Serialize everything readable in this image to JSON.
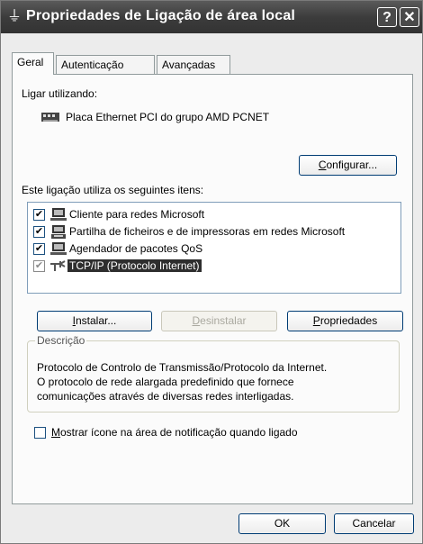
{
  "window": {
    "title": "Propriedades de Ligação de área local",
    "help_btn": "?",
    "close_btn": "✕"
  },
  "tabs": [
    {
      "label": "Geral",
      "active": true
    },
    {
      "label": "Autenticação",
      "active": false
    },
    {
      "label": "Avançadas",
      "active": false
    }
  ],
  "general": {
    "connect_using_label": "Ligar utilizando:",
    "adapter_name": "Placa Ethernet PCI do grupo AMD PCNET",
    "configure_button": "Configurar...",
    "items_label": "Este ligação utiliza os seguintes itens:",
    "items": [
      {
        "label": "Cliente para redes Microsoft",
        "checked": true,
        "icon": "network-client-icon"
      },
      {
        "label": "Partilha de ficheiros e de impressoras em redes Microsoft",
        "checked": true,
        "icon": "file-printer-sharing-icon"
      },
      {
        "label": "Agendador de pacotes QoS",
        "checked": true,
        "icon": "qos-scheduler-icon"
      },
      {
        "label": "TCP/IP (Protocolo Internet)",
        "checked": true,
        "icon": "protocol-icon",
        "selected": true
      }
    ],
    "install_button": "Instalar...",
    "uninstall_button": "Desinstalar",
    "properties_button": "Propriedades",
    "description_legend": "Descrição",
    "description_lines": [
      "Protocolo de Controlo de Transmissão/Protocolo da Internet.",
      "O protocolo de rede alargada predefinido que fornece",
      "comunicações através de diversas redes interligadas."
    ],
    "show_icon_label": "Mostrar ícone na área de notificação quando ligado",
    "show_icon_checked": false
  },
  "footer": {
    "ok_button": "OK",
    "cancel_button": "Cancelar"
  }
}
